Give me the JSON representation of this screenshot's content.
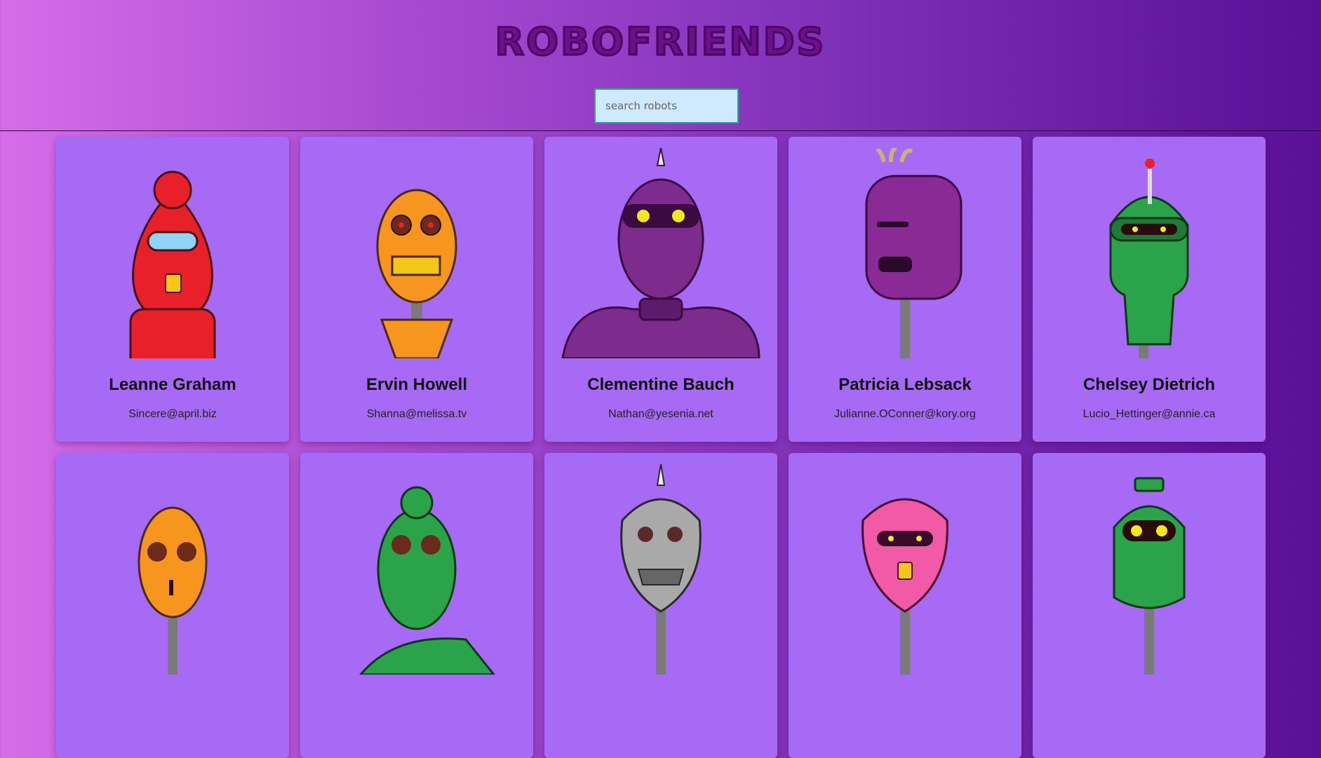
{
  "header": {
    "logo_text": "ROBOFRIENDS"
  },
  "search": {
    "placeholder": "search robots",
    "value": ""
  },
  "robots": [
    {
      "name": "Leanne Graham",
      "email": "Sincere@april.biz",
      "color": "#e8202a"
    },
    {
      "name": "Ervin Howell",
      "email": "Shanna@melissa.tv",
      "color": "#f7961e"
    },
    {
      "name": "Clementine Bauch",
      "email": "Nathan@yesenia.net",
      "color": "#7e2b8e"
    },
    {
      "name": "Patricia Lebsack",
      "email": "Julianne.OConner@kory.org",
      "color": "#8a2a96"
    },
    {
      "name": "Chelsey Dietrich",
      "email": "Lucio_Hettinger@annie.ca",
      "color": "#2aa34a"
    },
    {
      "name": "",
      "email": "",
      "color": "#f7961e"
    },
    {
      "name": "",
      "email": "",
      "color": "#2aa34a"
    },
    {
      "name": "",
      "email": "",
      "color": "#a9a9a9"
    },
    {
      "name": "",
      "email": "",
      "color": "#f25aa8"
    },
    {
      "name": "",
      "email": "",
      "color": "#2aa34a"
    }
  ]
}
